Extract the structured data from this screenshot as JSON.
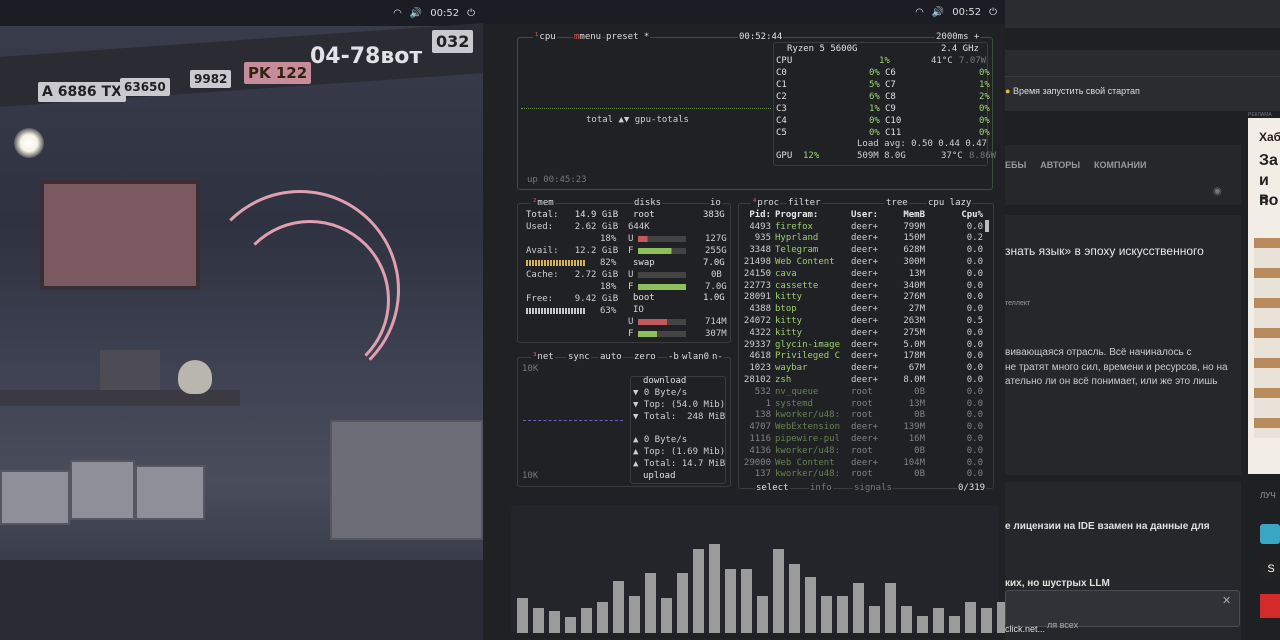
{
  "left_bar": {
    "time": "00:52"
  },
  "wallpaper": {
    "plates": [
      "A 6886 TX",
      "63650",
      "9982",
      "PK 122",
      "04-78вот",
      "032"
    ]
  },
  "btop": {
    "top_bar": {
      "time": "00:52"
    },
    "cpu_box": {
      "title": "cpu",
      "menu": "menu",
      "preset": "preset *",
      "clock": "00:52:44",
      "refresh": "2000ms +",
      "graph_label": "total ▲▼ gpu-totals",
      "uptime": "up 00:45:23",
      "model": "Ryzen 5 5600G",
      "freq": "2.4 GHz",
      "cpu_row": {
        "name": "CPU",
        "pct": "1%",
        "temp": "41°C",
        "watt": "7.07W"
      },
      "cores": [
        [
          "C0",
          "0%",
          "C6",
          "0%"
        ],
        [
          "C1",
          "5%",
          "C7",
          "1%"
        ],
        [
          "C2",
          "6%",
          "C8",
          "2%"
        ],
        [
          "C3",
          "1%",
          "C9",
          "0%"
        ],
        [
          "C4",
          "0%",
          "C10",
          "0%"
        ],
        [
          "C5",
          "0%",
          "C11",
          "0%"
        ]
      ],
      "load": "Load avg: 0.50 0.44 0.47",
      "gpu_row": {
        "name": "GPU",
        "pct": "12%",
        "mem": "509M 8.0G",
        "temp": "37°C",
        "watt": "8.86W"
      }
    },
    "mem_box": {
      "title": "mem",
      "total": "Total:   14.9 GiB",
      "used": "Used:    2.62 GiB",
      "used_pct": "18%",
      "avail": "Avail:   12.2 GiB",
      "avail_pct": "82%",
      "cache": "Cache:   2.72 GiB",
      "cache_pct": "18%",
      "free": "Free:    9.42 GiB",
      "free_pct": "63%"
    },
    "disks_box": {
      "title": "disks",
      "io": "io",
      "root": "root",
      "root_size": "383G",
      "root_io": "644K",
      "u1": "U",
      "u1v": "127G",
      "f1": "F",
      "f1v": "255G",
      "swap": "swap",
      "swap_size": "7.0G",
      "u2": "U",
      "u2v": "0B",
      "f2": "F",
      "f2v": "7.0G",
      "boot": "boot",
      "boot_size": "1.0G",
      "io2": "IO",
      "u3": "U",
      "u3v": "714M",
      "f3": "F",
      "f3v": "307M"
    },
    "net_box": {
      "title": "net",
      "sync": "sync",
      "auto": "auto",
      "zero": "zero",
      "b": "-b",
      "iface": "wlan0",
      "n": "n-",
      "scale_top": "10K",
      "scale_bottom": "10K",
      "download": "download",
      "dl_rate": "▼ 0 Byte/s",
      "dl_top": "▼ Top: (54.0 Mib)",
      "dl_total": "▼ Total:  248 MiB",
      "ul_rate": "▲ 0 Byte/s",
      "ul_top": "▲ Top: (1.69 Mib)",
      "ul_total": "▲ Total: 14.7 MiB",
      "upload": "upload"
    },
    "proc_box": {
      "title": "proc",
      "filter": "filter",
      "tree": "tree",
      "sort": "cpu lazy",
      "headers": [
        "Pid:",
        "Program:",
        "User:",
        "MemB",
        "Cpu%"
      ],
      "rows": [
        [
          "4493",
          "firefox",
          "deer+",
          "799M",
          "0.0"
        ],
        [
          "935",
          "Hyprland",
          "deer+",
          "150M",
          "0.2"
        ],
        [
          "3348",
          "Telegram",
          "deer+",
          "628M",
          "0.0"
        ],
        [
          "21498",
          "Web Content",
          "deer+",
          "300M",
          "0.0"
        ],
        [
          "24150",
          "cava",
          "deer+",
          "13M",
          "0.0"
        ],
        [
          "22773",
          "cassette",
          "deer+",
          "340M",
          "0.0"
        ],
        [
          "28091",
          "kitty",
          "deer+",
          "276M",
          "0.0"
        ],
        [
          "4388",
          "btop",
          "deer+",
          "27M",
          "0.0"
        ],
        [
          "24072",
          "kitty",
          "deer+",
          "263M",
          "0.5"
        ],
        [
          "4322",
          "kitty",
          "deer+",
          "275M",
          "0.0"
        ],
        [
          "29337",
          "glycin-image",
          "deer+",
          "5.0M",
          "0.0"
        ],
        [
          "4618",
          "Privileged C",
          "deer+",
          "178M",
          "0.0"
        ],
        [
          "1023",
          "waybar",
          "deer+",
          "67M",
          "0.0"
        ],
        [
          "28102",
          "zsh",
          "deer+",
          "8.0M",
          "0.0"
        ],
        [
          "532",
          "nv_queue",
          "root",
          "0B",
          "0.0"
        ],
        [
          "1",
          "systemd",
          "root",
          "13M",
          "0.0"
        ],
        [
          "138",
          "kworker/u48:",
          "root",
          "0B",
          "0.0"
        ],
        [
          "4707",
          "WebExtension",
          "deer+",
          "139M",
          "0.0"
        ],
        [
          "1116",
          "pipewire-pul",
          "deer+",
          "16M",
          "0.0"
        ],
        [
          "4136",
          "kworker/u48:",
          "root",
          "0B",
          "0.0"
        ],
        [
          "29000",
          "Web Content",
          "deer+",
          "104M",
          "0.0"
        ],
        [
          "137",
          "kworker/u48:",
          "root",
          "0B",
          "0.0"
        ]
      ],
      "select": "select",
      "info": "info",
      "signals": "signals",
      "count": "0/319"
    },
    "cava_bars": [
      0.28,
      0.2,
      0.18,
      0.13,
      0.2,
      0.25,
      0.42,
      0.3,
      0.48,
      0.28,
      0.48,
      0.68,
      0.72,
      0.52,
      0.52,
      0.3,
      0.68,
      0.56,
      0.45,
      0.3,
      0.3,
      0.4,
      0.22,
      0.4,
      0.22,
      0.14,
      0.2,
      0.14,
      0.25,
      0.2,
      0.25,
      0.28
    ]
  },
  "browser": {
    "bookmark": "Время запустить свой стартап",
    "nav": [
      "ЕБЫ",
      "АВТОРЫ",
      "КОМПАНИИ"
    ],
    "article_title": "знать язык» в эпоху искусственного",
    "tag": "теллект",
    "lead1": "вивающаяся отрасль. Всё начиналось с",
    "lead2": "не тратят много сил, времени и ресурсов, но на",
    "lead3": "ательно ли он всё понимает, или же это лишь",
    "side_ad": "Хаб",
    "side_big": [
      "За",
      "и в",
      "по"
    ],
    "news1": "е лицензии на IDE взамен на данные для",
    "news2": "ких, но шустрых LLM",
    "best": "ЛУЧ",
    "url": "click.net...",
    "footer": "ля всех",
    "ad_label": "РЕКЛАМА"
  }
}
